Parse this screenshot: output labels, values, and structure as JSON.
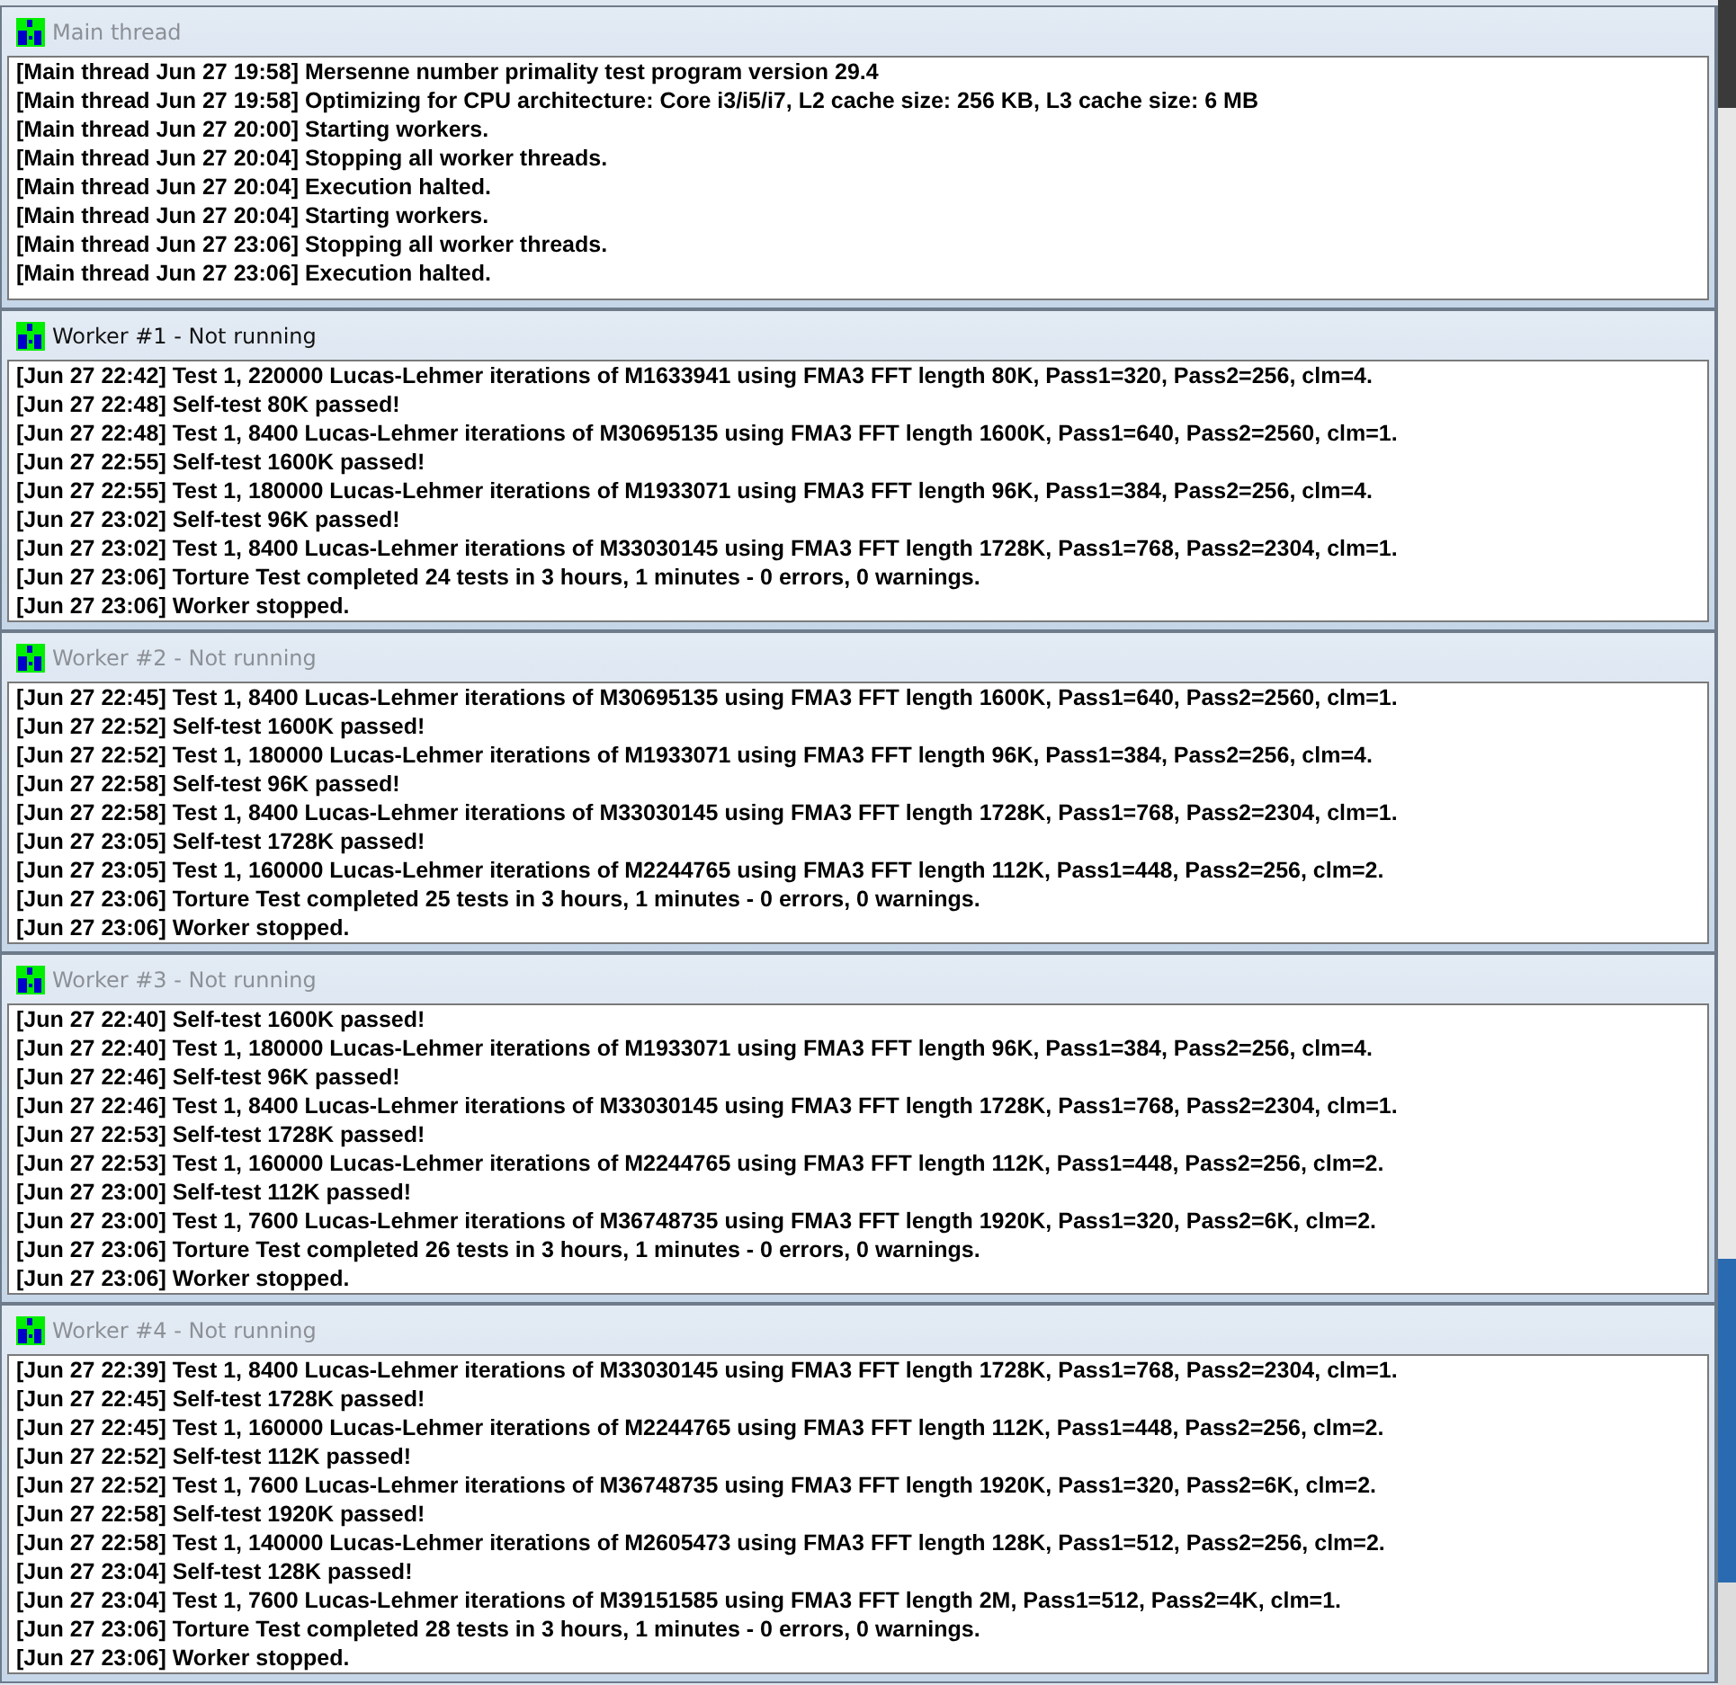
{
  "windows": [
    {
      "title": "Main thread",
      "active": false,
      "lines": [
        "[Main thread Jun 27 19:58] Mersenne number primality test program version 29.4",
        "[Main thread Jun 27 19:58] Optimizing for CPU architecture: Core i3/i5/i7, L2 cache size: 256 KB, L3 cache size: 6 MB",
        "[Main thread Jun 27 20:00] Starting workers.",
        "[Main thread Jun 27 20:04] Stopping all worker threads.",
        "[Main thread Jun 27 20:04] Execution halted.",
        "[Main thread Jun 27 20:04] Starting workers.",
        "[Main thread Jun 27 23:06] Stopping all worker threads.",
        "[Main thread Jun 27 23:06] Execution halted."
      ]
    },
    {
      "title": "Worker #1 - Not running",
      "active": true,
      "lines": [
        "[Jun 27 22:42] Test 1, 220000 Lucas-Lehmer iterations of M1633941 using FMA3 FFT length 80K, Pass1=320, Pass2=256, clm=4.",
        "[Jun 27 22:48] Self-test 80K passed!",
        "[Jun 27 22:48] Test 1, 8400 Lucas-Lehmer iterations of M30695135 using FMA3 FFT length 1600K, Pass1=640, Pass2=2560, clm=1.",
        "[Jun 27 22:55] Self-test 1600K passed!",
        "[Jun 27 22:55] Test 1, 180000 Lucas-Lehmer iterations of M1933071 using FMA3 FFT length 96K, Pass1=384, Pass2=256, clm=4.",
        "[Jun 27 23:02] Self-test 96K passed!",
        "[Jun 27 23:02] Test 1, 8400 Lucas-Lehmer iterations of M33030145 using FMA3 FFT length 1728K, Pass1=768, Pass2=2304, clm=1.",
        "[Jun 27 23:06] Torture Test completed 24 tests in 3 hours, 1 minutes - 0 errors, 0 warnings.",
        "[Jun 27 23:06] Worker stopped."
      ]
    },
    {
      "title": "Worker #2 - Not running",
      "active": false,
      "lines": [
        "[Jun 27 22:45] Test 1, 8400 Lucas-Lehmer iterations of M30695135 using FMA3 FFT length 1600K, Pass1=640, Pass2=2560, clm=1.",
        "[Jun 27 22:52] Self-test 1600K passed!",
        "[Jun 27 22:52] Test 1, 180000 Lucas-Lehmer iterations of M1933071 using FMA3 FFT length 96K, Pass1=384, Pass2=256, clm=4.",
        "[Jun 27 22:58] Self-test 96K passed!",
        "[Jun 27 22:58] Test 1, 8400 Lucas-Lehmer iterations of M33030145 using FMA3 FFT length 1728K, Pass1=768, Pass2=2304, clm=1.",
        "[Jun 27 23:05] Self-test 1728K passed!",
        "[Jun 27 23:05] Test 1, 160000 Lucas-Lehmer iterations of M2244765 using FMA3 FFT length 112K, Pass1=448, Pass2=256, clm=2.",
        "[Jun 27 23:06] Torture Test completed 25 tests in 3 hours, 1 minutes - 0 errors, 0 warnings.",
        "[Jun 27 23:06] Worker stopped."
      ]
    },
    {
      "title": "Worker #3 - Not running",
      "active": false,
      "lines": [
        "[Jun 27 22:40] Self-test 1600K passed!",
        "[Jun 27 22:40] Test 1, 180000 Lucas-Lehmer iterations of M1933071 using FMA3 FFT length 96K, Pass1=384, Pass2=256, clm=4.",
        "[Jun 27 22:46] Self-test 96K passed!",
        "[Jun 27 22:46] Test 1, 8400 Lucas-Lehmer iterations of M33030145 using FMA3 FFT length 1728K, Pass1=768, Pass2=2304, clm=1.",
        "[Jun 27 22:53] Self-test 1728K passed!",
        "[Jun 27 22:53] Test 1, 160000 Lucas-Lehmer iterations of M2244765 using FMA3 FFT length 112K, Pass1=448, Pass2=256, clm=2.",
        "[Jun 27 23:00] Self-test 112K passed!",
        "[Jun 27 23:00] Test 1, 7600 Lucas-Lehmer iterations of M36748735 using FMA3 FFT length 1920K, Pass1=320, Pass2=6K, clm=2.",
        "[Jun 27 23:06] Torture Test completed 26 tests in 3 hours, 1 minutes - 0 errors, 0 warnings.",
        "[Jun 27 23:06] Worker stopped."
      ]
    },
    {
      "title": "Worker #4 - Not running",
      "active": false,
      "lines": [
        "[Jun 27 22:39] Test 1, 8400 Lucas-Lehmer iterations of M33030145 using FMA3 FFT length 1728K, Pass1=768, Pass2=2304, clm=1.",
        "[Jun 27 22:45] Self-test 1728K passed!",
        "[Jun 27 22:45] Test 1, 160000 Lucas-Lehmer iterations of M2244765 using FMA3 FFT length 112K, Pass1=448, Pass2=256, clm=2.",
        "[Jun 27 22:52] Self-test 112K passed!",
        "[Jun 27 22:52] Test 1, 7600 Lucas-Lehmer iterations of M36748735 using FMA3 FFT length 1920K, Pass1=320, Pass2=6K, clm=2.",
        "[Jun 27 22:58] Self-test 1920K passed!",
        "[Jun 27 22:58] Test 1, 140000 Lucas-Lehmer iterations of M2605473 using FMA3 FFT length 128K, Pass1=512, Pass2=256, clm=2.",
        "[Jun 27 23:04] Self-test 128K passed!",
        "[Jun 27 23:04] Test 1, 7600 Lucas-Lehmer iterations of M39151585 using FMA3 FFT length 2M, Pass1=512, Pass2=4K, clm=1.",
        "[Jun 27 23:06] Torture Test completed 28 tests in 3 hours, 1 minutes - 0 errors, 0 warnings.",
        "[Jun 27 23:06] Worker stopped."
      ]
    }
  ]
}
